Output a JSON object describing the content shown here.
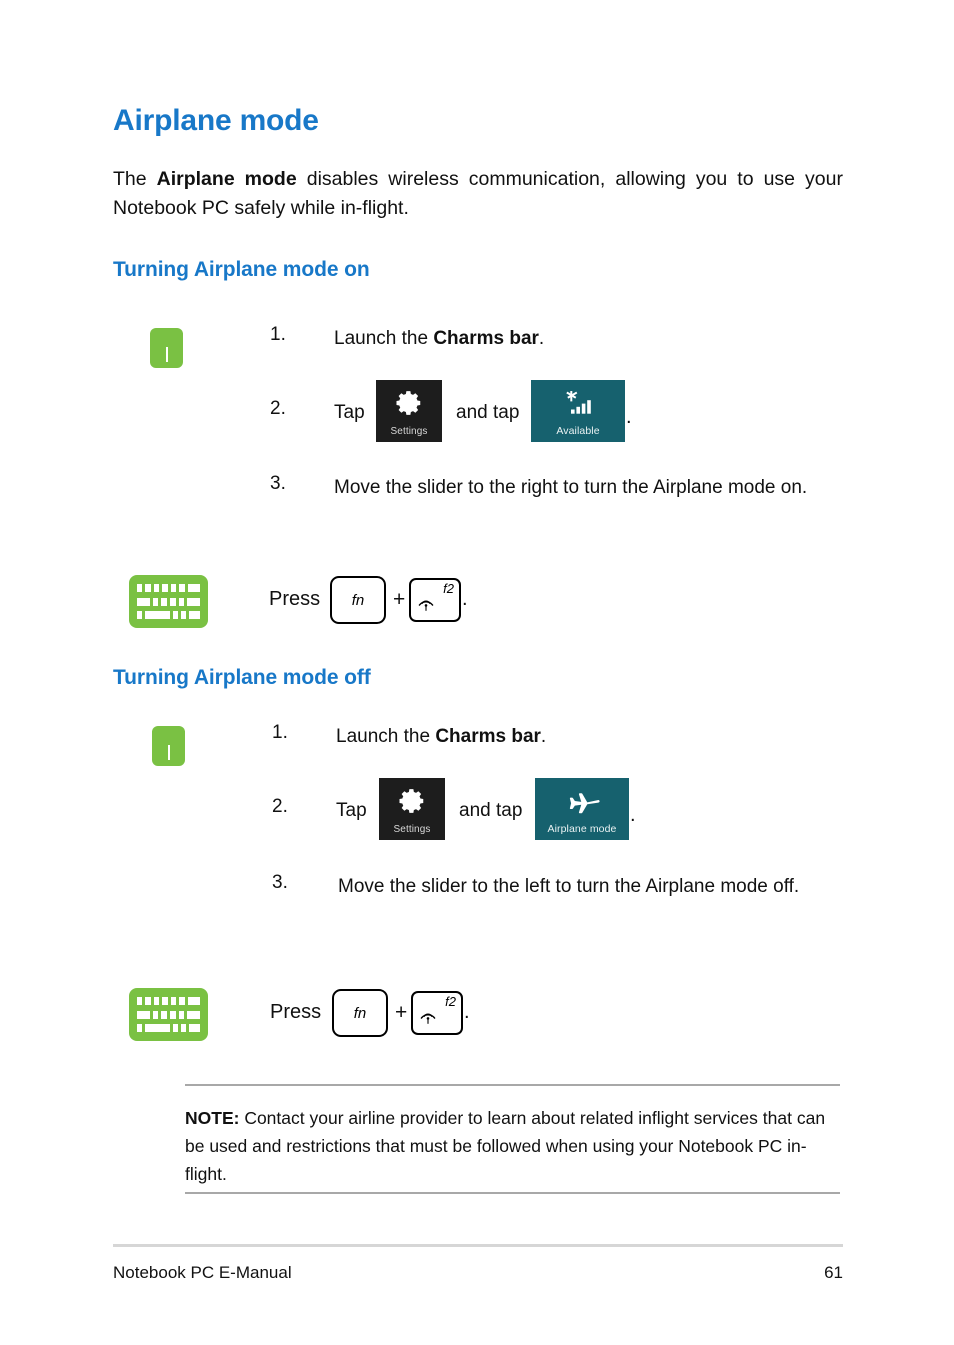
{
  "page": {
    "title": "Airplane mode",
    "intro_prefix": "The ",
    "intro_bold": "Airplane mode",
    "intro_suffix": " disables wireless communication, allowing you to use your Notebook PC safely while in-flight.",
    "accent_color": "#1878c8",
    "green_color": "#7ac143",
    "teal_color": "#16616e",
    "tile_dark_color": "#1d1d1d"
  },
  "section_on": {
    "heading": "Turning Airplane mode on",
    "touchpad_icon": "touchpad-icon",
    "steps": [
      {
        "num": "1.",
        "text_prefix": "Launch the ",
        "text_bold": "Charms bar",
        "text_suffix": "."
      },
      {
        "num": "2.",
        "text_prefix": "Tap",
        "text_mid": "and tap",
        "text_suffix": "."
      },
      {
        "num": "3.",
        "text": "Move the slider to the right to turn the Airplane mode on."
      }
    ],
    "tile_settings": {
      "caption": "Settings",
      "icon": "gear-icon"
    },
    "tile_network": {
      "caption": "Available",
      "icon": "wifi-signal-icon"
    },
    "shortcut": {
      "press_label": "Press",
      "key1": "fn",
      "plus": "+",
      "key2_label": "f2",
      "key2_icon": "wireless-icon",
      "period": "."
    },
    "keyboard_icon": "keyboard-icon"
  },
  "section_off": {
    "heading": "Turning Airplane mode off",
    "touchpad_icon": "touchpad-icon",
    "steps": [
      {
        "num": "1.",
        "text_prefix": "Launch the ",
        "text_bold": "Charms bar",
        "text_suffix": "."
      },
      {
        "num": "2.",
        "text_prefix": "Tap",
        "text_mid": "and tap",
        "text_suffix": "."
      },
      {
        "num": "3.",
        "text": "Move the slider to the left to turn the Airplane mode off."
      }
    ],
    "tile_settings": {
      "caption": "Settings",
      "icon": "gear-icon"
    },
    "tile_airplane": {
      "caption": "Airplane mode",
      "icon": "airplane-icon"
    },
    "shortcut": {
      "press_label": "Press",
      "key1": "fn",
      "plus": "+",
      "key2_label": "f2",
      "key2_icon": "wireless-icon",
      "period": "."
    },
    "keyboard_icon": "keyboard-icon"
  },
  "note": {
    "label": "NOTE:",
    "text": " Contact your airline provider to learn about related inflight services that can be used and restrictions that must be followed when using your Notebook PC in-flight."
  },
  "footer": {
    "left": "Notebook PC E-Manual",
    "page_number": "61"
  }
}
